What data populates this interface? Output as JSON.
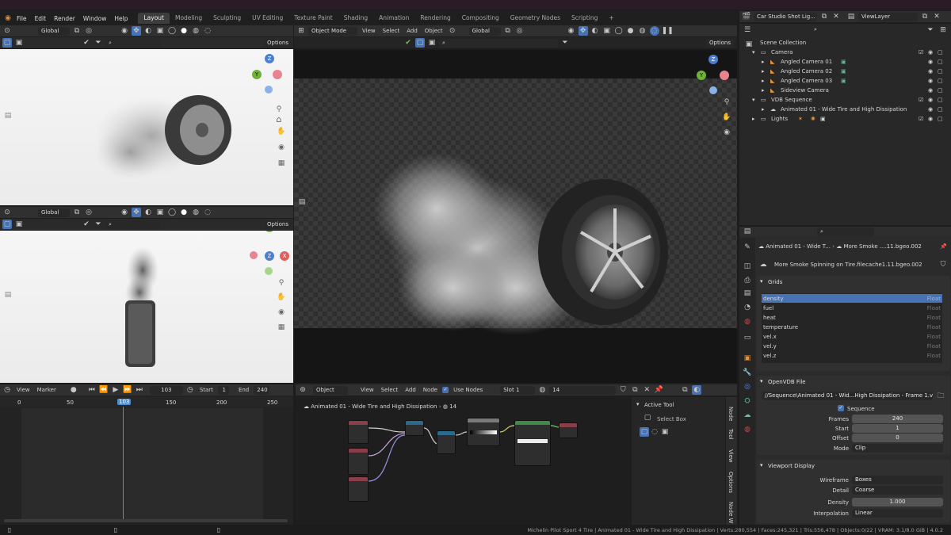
{
  "menu": {
    "items": [
      "File",
      "Edit",
      "Render",
      "Window",
      "Help"
    ],
    "workspaces": [
      "Layout",
      "Modeling",
      "Sculpting",
      "UV Editing",
      "Texture Paint",
      "Shading",
      "Animation",
      "Rendering",
      "Compositing",
      "Geometry Nodes",
      "Scripting"
    ],
    "active_workspace": "Layout",
    "add_tab": "+"
  },
  "scene": {
    "name": "Car Studio Shot Lig...",
    "view_layer": "ViewLayer"
  },
  "viewport_left_top": {
    "orientation": "Global",
    "options": "Options",
    "gizmo": {
      "z": "Z",
      "y": "Y"
    }
  },
  "viewport_left_bottom": {
    "orientation": "Global",
    "options": "Options",
    "gizmo": {
      "y": "Y",
      "z": "Z",
      "x": "X"
    }
  },
  "viewport_main": {
    "mode": "Object Mode",
    "menus": [
      "View",
      "Select",
      "Add",
      "Object"
    ],
    "orientation": "Global",
    "options": "Options",
    "gizmo": {
      "z": "Z",
      "y": "Y"
    }
  },
  "outliner": {
    "root": "Scene Collection",
    "rows": [
      {
        "label": "Camera",
        "level": 1
      },
      {
        "label": "Angled Camera 01",
        "level": 2
      },
      {
        "label": "Angled Camera 02",
        "level": 2
      },
      {
        "label": "Angled Camera 03",
        "level": 2
      },
      {
        "label": "Sideview Camera",
        "level": 2
      },
      {
        "label": "VDB Sequence",
        "level": 1
      },
      {
        "label": "Animated 01 - Wide Tire and High Dissipation",
        "level": 2
      },
      {
        "label": "Lights",
        "level": 1
      }
    ]
  },
  "properties": {
    "breadcrumb_object": "Animated 01 - Wide T...",
    "breadcrumb_data": "More Smoke ....11.bgeo.002",
    "datablock": "More Smoke Spinning on Tire.filecache1.11.bgeo.002",
    "grids_title": "Grids",
    "grids": [
      {
        "name": "density",
        "type": "Float"
      },
      {
        "name": "fuel",
        "type": "Float"
      },
      {
        "name": "heat",
        "type": "Float"
      },
      {
        "name": "temperature",
        "type": "Float"
      },
      {
        "name": "vel.x",
        "type": "Float"
      },
      {
        "name": "vel.y",
        "type": "Float"
      },
      {
        "name": "vel.z",
        "type": "Float"
      }
    ],
    "openvdb_title": "OpenVDB File",
    "file_path": "//Sequence\\Animated 01 - Wid...High Dissipation - Frame 1.vdb",
    "sequence_label": "Sequence",
    "frames_label": "Frames",
    "frames": "240",
    "start_label": "Start",
    "start": "1",
    "offset_label": "Offset",
    "offset": "0",
    "mode_label": "Mode",
    "mode": "Clip",
    "viewport_title": "Viewport Display",
    "wireframe_label": "Wireframe",
    "wireframe": "Boxes",
    "detail_label": "Detail",
    "detail": "Coarse",
    "density_label": "Density",
    "density": "1.000",
    "interp_label": "Interpolation",
    "interp": "Linear"
  },
  "timeline": {
    "menus": [
      "View",
      "Marker"
    ],
    "current_frame": "103",
    "start_label": "Start",
    "start": "1",
    "end_label": "End",
    "end": "240",
    "ticks": [
      "0",
      "50",
      "103",
      "150",
      "200",
      "250"
    ]
  },
  "node_editor": {
    "type": "Object",
    "menus": [
      "View",
      "Select",
      "Add",
      "Node"
    ],
    "use_nodes_label": "Use Nodes",
    "slot": "Slot 1",
    "material": "14",
    "breadcrumb_object": "Animated 01 - Wide Tire and High Dissipation",
    "breadcrumb_material": "14",
    "active_tool_title": "Active Tool",
    "active_tool": "Select Box",
    "side_tabs": [
      "Node",
      "Tool",
      "View",
      "Options",
      "Node W"
    ]
  },
  "statusbar": {
    "text": "Michelin Pilot Sport 4 Tire | Animated 01 - Wide Tire and High Dissipation | Verts:280,554 | Faces:245,321 | Tris:556,478 | Objects:0/22 | VRAM: 3.1/8.0 GiB | 4.0.2"
  },
  "colors": {
    "accent": "#4772b3",
    "background": "#1d1d1d",
    "header": "#303030",
    "playhead": "#4a8fd6"
  }
}
